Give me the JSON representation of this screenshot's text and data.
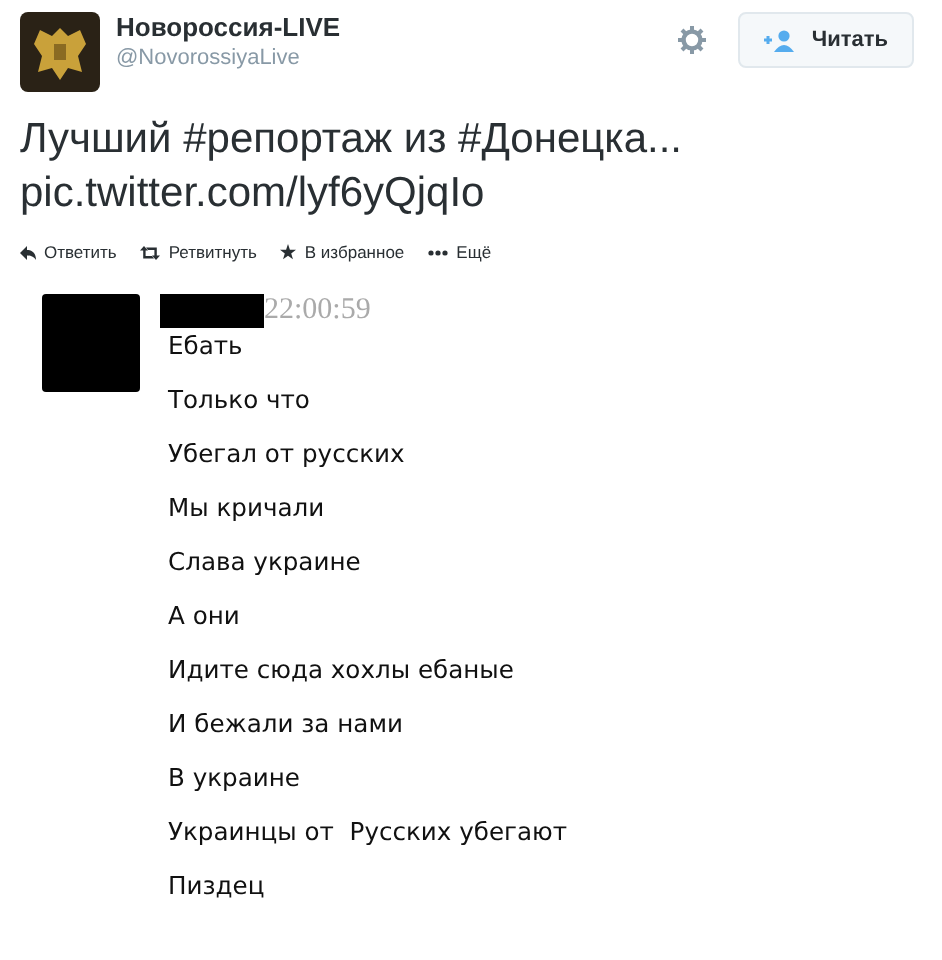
{
  "account": {
    "name": "Новороссия-LIVE",
    "handle": "@NovorossiyaLive"
  },
  "follow_button": {
    "label": "Читать"
  },
  "tweet": {
    "line_1": "Лучший #репортаж из #Донецка...",
    "line_2": "pic.twitter.com/lyf6yQjqIo"
  },
  "actions": [
    {
      "kind": "reply",
      "label": "Ответить"
    },
    {
      "kind": "retweet",
      "label": "Ретвитнуть"
    },
    {
      "kind": "favorite",
      "label": "В избранное"
    },
    {
      "kind": "more",
      "label": "Ещё"
    }
  ],
  "chat": {
    "time": "22:00:59",
    "messages": [
      "Ебать",
      "Только что",
      "Убегал от русских",
      "Мы кричали",
      "Слава украине",
      "А они",
      "Идите сюда хохлы ебаные",
      "И бежали за нами",
      "В украине",
      "Украинцы от  Русских убегают",
      "Пиздец"
    ]
  }
}
